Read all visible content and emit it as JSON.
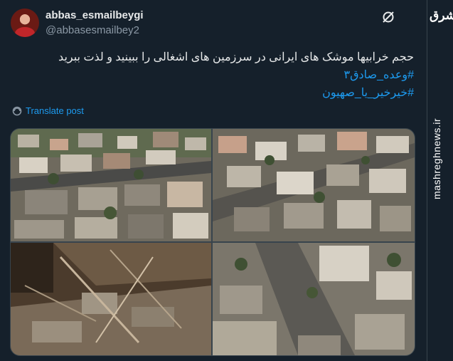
{
  "post": {
    "display_name": "abbas_esmailbeygi",
    "handle": "@abbasesmailbey2",
    "text_lines": [
      "حجم خرابیها موشک های ایرانی در سرزمین های اشغالی را ببینید و لذت ببرید",
      "#وعده_صادق۳",
      "#خیرخیر_یا_صهیون"
    ],
    "translate_label": "Translate post"
  },
  "watermark": {
    "logo_text": "مشرق",
    "side_text": "mashreghnews.ir"
  },
  "colors": {
    "background": "#15202b",
    "accent": "#1d9bf0",
    "text": "#e7e9ea",
    "secondary": "#8b98a5"
  },
  "icons": [
    "grok-icon",
    "translate-icon"
  ]
}
